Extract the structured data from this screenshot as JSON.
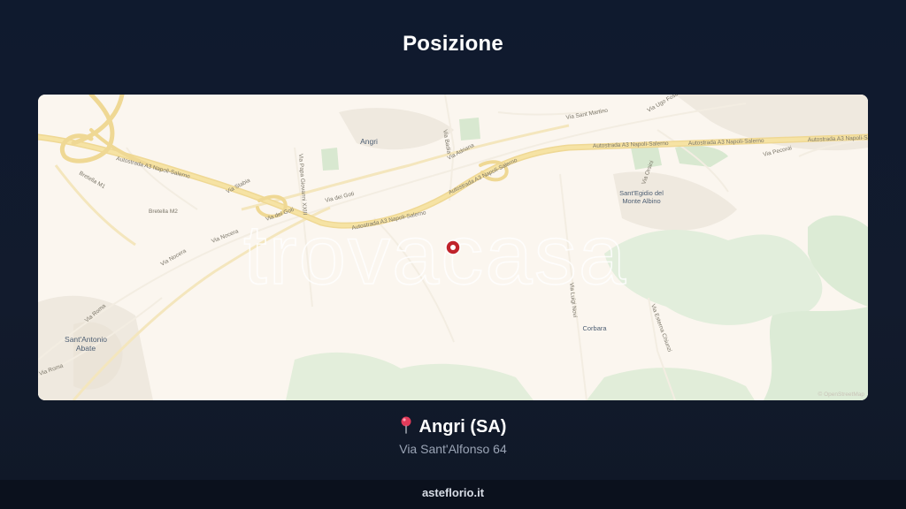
{
  "page": {
    "title": "Posizione",
    "footer": "asteflorio.it"
  },
  "location": {
    "pin_icon": "map-pin-icon",
    "city": "Angri (SA)",
    "address": "Via Sant'Alfonso 64"
  },
  "map": {
    "watermark": "trovacasa",
    "attribution": "© OpenStreetMap",
    "marker_color": "#c0232b",
    "places": {
      "angri": "Angri",
      "santegidio_1": "Sant'Egidio del",
      "santegidio_2": "Monte Albino",
      "santantonio_1": "Sant'Antonio",
      "santantonio_2": "Abate",
      "corbara": "Corbara"
    },
    "roads": {
      "a3_1": "Autostrada A3 Napoli-Salerno",
      "a3_2": "Autostrada A3 Napoli-Salerno",
      "a3_3": "Autostrada A3 Napoli-Salerno",
      "a3_4": "Autostrada A3 Napoli-Salerno",
      "a3_5": "Autostrada A3 Napoli-Salerno",
      "a3_6": "Autostrada A3 Napoli-Salerno",
      "via_dei_goti_1": "Via dei Goti",
      "via_dei_goti_2": "Via dei Goti",
      "via_nocera_1": "Via Nocera",
      "via_nocera_2": "Via Nocera",
      "via_roma_1": "Via Roma",
      "via_roma_2": "Via Roma",
      "via_badia": "Via Badia",
      "via_adriana": "Via Adriana",
      "via_luigi_novi": "Via Luigi Novi",
      "via_esterna_chiunzi": "Via Esterna Chiunzi",
      "bretella_1": "Bretella M1",
      "bretella_2": "Bretella M2",
      "via_stabia": "Via Stabia",
      "via_papa_giovanni": "Via Papa Giovanni XXIII",
      "via_sant_martino": "Via Sant Martino",
      "via_ugo_foscolo": "Via Ugo Foscolo",
      "via_pecorai": "Via Pecorai",
      "via_orsini": "Via Orsini"
    }
  }
}
